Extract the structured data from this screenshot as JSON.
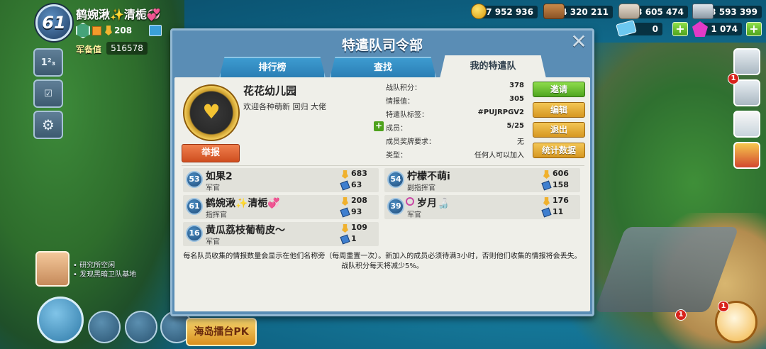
{
  "player": {
    "level": "61",
    "name": "鹤婉湫✨清栀💞",
    "medals": "208",
    "armory_label": "军备值",
    "armory_value": "516578"
  },
  "resources": {
    "gold": "7 952 936",
    "wood": "4 320 211",
    "stone": "3 605 474",
    "iron": "3 593 399",
    "tickets": "0",
    "diamonds": "1 074"
  },
  "left_menu": [
    {
      "icon": "leaderboard-icon",
      "glyph": "1²₃"
    },
    {
      "icon": "calendar-icon",
      "glyph": "☑"
    },
    {
      "icon": "settings-icon",
      "glyph": "⚙"
    }
  ],
  "right_menu": [
    {
      "icon": "social-icon"
    },
    {
      "icon": "profile-icon"
    },
    {
      "icon": "checklist-icon"
    },
    {
      "icon": "gift-icon"
    }
  ],
  "notifications": {
    "profile": "1",
    "bottom_a": "1",
    "bottom_b": "1"
  },
  "hints": [
    "研究所空闲",
    "发现黑暗卫队基地"
  ],
  "banner_text": "海岛擂台PK",
  "dialog": {
    "title": "特遣队司令部",
    "close_icon": "close-icon",
    "tabs": [
      {
        "label": "排行榜",
        "active": false
      },
      {
        "label": "查找",
        "active": false
      },
      {
        "label": "我的特遣队",
        "active": true
      }
    ]
  },
  "crew": {
    "name": "花花幼儿园",
    "motto": "欢迎各种萌新 回归 大佬",
    "report_label": "举报",
    "info": [
      {
        "label": "战队积分：",
        "value": "378",
        "icon": "medal-wing-icon"
      },
      {
        "label": "情报值：",
        "value": "305",
        "icon": "intel-icon"
      },
      {
        "label": "特遣队标签：",
        "value": "#PUJRPGV2"
      },
      {
        "label": "成员：",
        "value": "5/25"
      },
      {
        "label": "成员奖牌要求：",
        "value": "无",
        "icon": "medal-icon"
      },
      {
        "label": "类型：",
        "value": "任何人可以加入"
      }
    ],
    "actions": {
      "invite": "邀请",
      "edit": "编辑",
      "leave": "退出",
      "stats": "统计数据"
    }
  },
  "members": [
    {
      "level": "53",
      "name": "如果2",
      "role": "军官",
      "medals": "683",
      "intel": "63"
    },
    {
      "level": "54",
      "name": "柠檬不萌i",
      "role": "副指挥官",
      "medals": "606",
      "intel": "158"
    },
    {
      "level": "61",
      "name": "鹤婉湫✨清栀💞",
      "role": "指挥官",
      "medals": "208",
      "intel": "93"
    },
    {
      "level": "39",
      "name": "岁月🍶",
      "role": "军官",
      "medals": "176",
      "intel": "11"
    },
    {
      "level": "16",
      "name": "黄瓜荔枝葡萄皮～",
      "role": "军官",
      "medals": "109",
      "intel": "1"
    }
  ],
  "footer_note": {
    "line1": "每名队员收集的情报数量会显示在他们名称旁（每周重置一次）。新加入的成员必须待满3小时，否则他们收集的情报将会丢失。",
    "line2": "战队积分每天将减少5%。"
  }
}
